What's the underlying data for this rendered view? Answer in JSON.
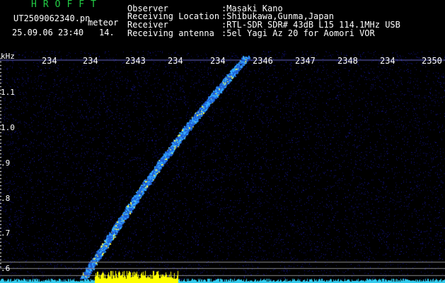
{
  "header": {
    "brand": "HROFFT",
    "file_name": "UT2509062340.pn",
    "meteor_label": "meteor",
    "date_time": "25.09.06 23:40",
    "count": "14.",
    "info_labels": [
      "Observer",
      "Receiving Location",
      "Receiver",
      "Receiving antenna"
    ],
    "info_values": [
      ":Masaki Kano",
      ":Shibukawa,Gunma,Japan",
      ":RTL-SDR SDR# 43dB L15 114.1MHz USB",
      ":5el Yagi Az 20 for Aomori VOR"
    ]
  },
  "axes": {
    "y_unit": "kHz",
    "x_ticks": [
      "234",
      "234",
      "2343",
      "234",
      "234",
      "2346",
      "2347",
      "2348",
      "234",
      "2350"
    ],
    "y_ticks": [
      "1.1",
      "1.0",
      ".9",
      ".8",
      ".7",
      ".6"
    ]
  },
  "colors": {
    "background": "#000000",
    "brand": "#22cc44",
    "echo": "#33aaff",
    "echo_core": "#ffff33",
    "noise": "#1a1a99"
  }
}
